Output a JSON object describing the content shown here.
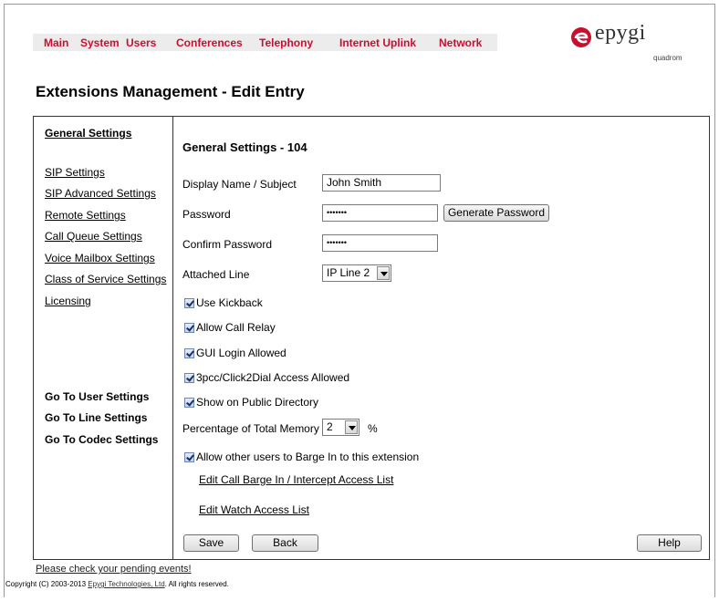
{
  "nav": {
    "items": [
      "Main",
      "System",
      "Users",
      "Conferences",
      "Telephony",
      "Internet Uplink",
      "Network"
    ]
  },
  "logo": {
    "text": "epygi",
    "sub": "quadrom"
  },
  "page_title": "Extensions Management - Edit Entry",
  "sidebar": {
    "items": [
      {
        "label": "General Settings",
        "bold": true
      },
      {
        "label": "SIP Settings"
      },
      {
        "label": "SIP Advanced Settings"
      },
      {
        "label": "Remote Settings"
      },
      {
        "label": "Call Queue Settings"
      },
      {
        "label": "Voice Mailbox Settings"
      },
      {
        "label": "Class of Service Settings"
      },
      {
        "label": "Licensing"
      }
    ],
    "goto": [
      "Go To User Settings",
      "Go To Line Settings",
      "Go To Codec Settings"
    ]
  },
  "form": {
    "section_title": "General Settings - 104",
    "display_name_label": "Display Name / Subject",
    "display_name_value": "John Smith",
    "password_label": "Password",
    "password_value": "•••••••",
    "generate_password_label": "Generate Password",
    "confirm_password_label": "Confirm Password",
    "confirm_password_value": "•••••••",
    "attached_line_label": "Attached Line",
    "attached_line_value": "IP Line 2",
    "checkboxes": [
      {
        "label": "Use Kickback",
        "checked": true
      },
      {
        "label": "Allow Call Relay",
        "checked": true
      },
      {
        "label": "GUI Login Allowed",
        "checked": true
      },
      {
        "label": "3pcc/Click2Dial Access Allowed",
        "checked": true
      },
      {
        "label": "Show on Public Directory",
        "checked": true
      }
    ],
    "memory_label": "Percentage of Total Memory",
    "memory_value": "2",
    "memory_unit": "%",
    "barge_label": "Allow other users to Barge In to this extension",
    "barge_checked": true,
    "edit_barge_link": "Edit Call Barge In / Intercept Access List",
    "edit_watch_link": "Edit Watch Access List",
    "save_label": "Save",
    "back_label": "Back",
    "help_label": "Help"
  },
  "footer": {
    "pending_events": "Please check your pending events!",
    "copyright_prefix": "Copyright (C) 2003-2013 ",
    "copyright_company": "Epygi Technologies, Ltd",
    "copyright_suffix": ". All rights reserved."
  },
  "colors": {
    "nav_text": "#c8102e",
    "nav_bg": "#ececec",
    "logo_red": "#c8102e"
  }
}
